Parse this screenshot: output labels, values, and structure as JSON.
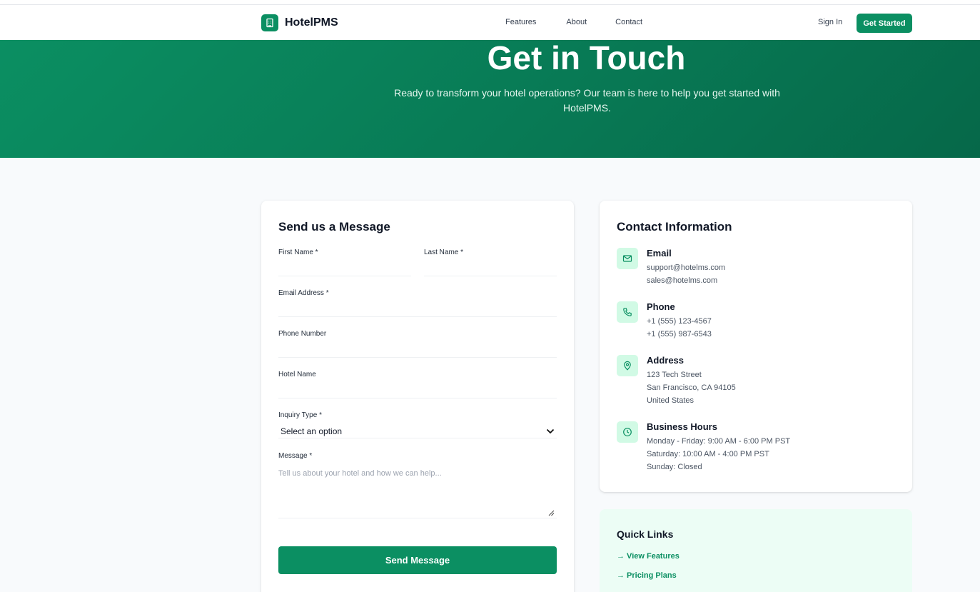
{
  "nav": {
    "brand": "HotelPMS",
    "links": [
      "Features",
      "About",
      "Contact"
    ],
    "sign_in": "Sign In",
    "get_started": "Get Started"
  },
  "hero": {
    "title": "Get in Touch",
    "subtitle": "Ready to transform your hotel operations? Our team is here to help you get started with HotelPMS."
  },
  "form": {
    "title": "Send us a Message",
    "first_name_label": "First Name *",
    "last_name_label": "Last Name *",
    "email_label": "Email Address *",
    "phone_label": "Phone Number",
    "hotel_label": "Hotel Name",
    "inquiry_label": "Inquiry Type *",
    "inquiry_value": "Select an option",
    "message_label": "Message *",
    "message_placeholder": "Tell us about your hotel and how we can help...",
    "submit": "Send Message"
  },
  "contact": {
    "title": "Contact Information",
    "email": {
      "title": "Email",
      "lines": [
        "support@hotelms.com",
        "sales@hotelms.com"
      ]
    },
    "phone": {
      "title": "Phone",
      "lines": [
        "+1 (555) 123-4567",
        "+1 (555) 987-6543"
      ]
    },
    "address": {
      "title": "Address",
      "lines": [
        "123 Tech Street",
        "San Francisco, CA 94105",
        "United States"
      ]
    },
    "hours": {
      "title": "Business Hours",
      "lines": [
        "Monday - Friday: 9:00 AM - 6:00 PM PST",
        "Saturday: 10:00 AM - 4:00 PM PST",
        "Sunday: Closed"
      ]
    }
  },
  "quick_links": {
    "title": "Quick Links",
    "items": [
      "→ View Features",
      "→ Pricing Plans"
    ]
  },
  "colors": {
    "accent": "#0b8f62",
    "icon_bg": "#d1fae5",
    "quick_bg": "#ecfdf5"
  }
}
